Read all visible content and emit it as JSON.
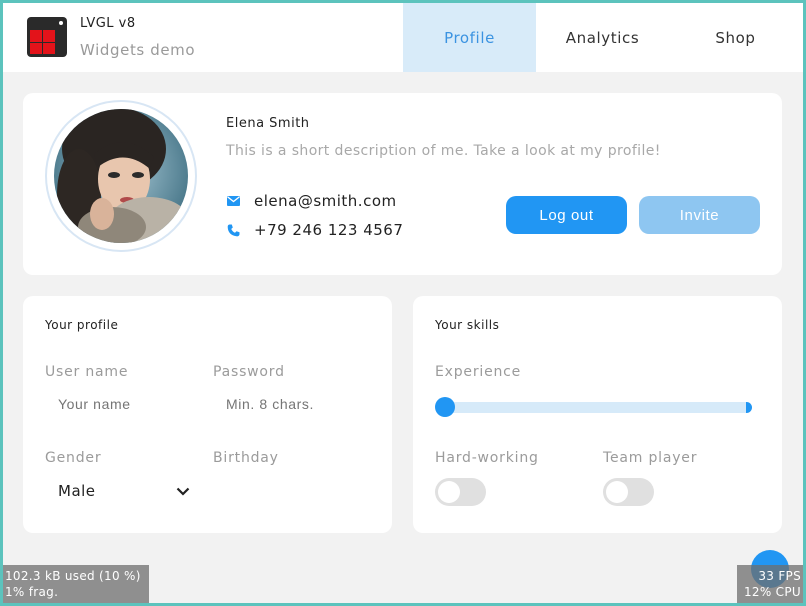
{
  "header": {
    "title": "LVGL v8",
    "subtitle": "Widgets demo",
    "tabs": [
      {
        "label": "Profile",
        "active": true
      },
      {
        "label": "Analytics",
        "active": false
      },
      {
        "label": "Shop",
        "active": false
      }
    ]
  },
  "profile": {
    "name": "Elena Smith",
    "description": "This is a short description of me. Take a look at my profile!",
    "email": "elena@smith.com",
    "phone": "+79 246 123 4567",
    "logout_label": "Log out",
    "invite_label": "Invite"
  },
  "your_profile": {
    "title": "Your profile",
    "username_label": "User name",
    "username_placeholder": "Your name",
    "password_label": "Password",
    "password_placeholder": "Min. 8 chars.",
    "gender_label": "Gender",
    "gender_value": "Male",
    "birthday_label": "Birthday"
  },
  "your_skills": {
    "title": "Your skills",
    "experience_label": "Experience",
    "experience_value": 0,
    "hardworking_label": "Hard-working",
    "hardworking_on": false,
    "teamplayer_label": "Team player",
    "teamplayer_on": false
  },
  "overlays": {
    "memory_line1": "102.3 kB used (10 %)",
    "memory_line2": "1% frag.",
    "fps": "33 FPS",
    "cpu": "12% CPU"
  },
  "colors": {
    "accent": "#2196f3",
    "tab_active_bg": "#d8ebf9",
    "invite_disabled": "#8ec6f1",
    "page_bg": "#f2f2f2",
    "border": "#5cc3bd"
  },
  "icons": {
    "email": "envelope-icon",
    "phone": "phone-icon",
    "dropdown": "chevron-down-icon"
  }
}
